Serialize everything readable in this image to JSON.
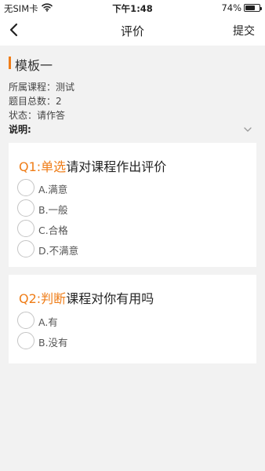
{
  "status_bar": {
    "carrier": "无SIM卡",
    "time": "下午1:48",
    "battery": "74%",
    "battery_level": 0.74,
    "icons": [
      "wifi-icon",
      "battery-icon"
    ]
  },
  "nav": {
    "back_icon": "chevron-left-icon",
    "title": "评价",
    "submit_label": "提交"
  },
  "template": {
    "name": "模板一",
    "course_label": "所属课程：",
    "course_value": "测试",
    "total_label": "题目总数：",
    "total_value": "2",
    "status_label": "状态：",
    "status_value": "请作答",
    "desc_label": "说明:",
    "expand_icon": "chevron-down-icon"
  },
  "colors": {
    "accent": "#ef7d18",
    "background": "#f2f2f2",
    "card": "#ffffff"
  },
  "questions": [
    {
      "number": "Q1:",
      "type": "单选",
      "text": "请对课程作出评价",
      "options": [
        "A.满意",
        "B.一般",
        "C.合格",
        "D.不满意"
      ]
    },
    {
      "number": "Q2:",
      "type": "判断",
      "text": "课程对你有用吗",
      "options": [
        "A.有",
        "B.没有"
      ]
    }
  ]
}
